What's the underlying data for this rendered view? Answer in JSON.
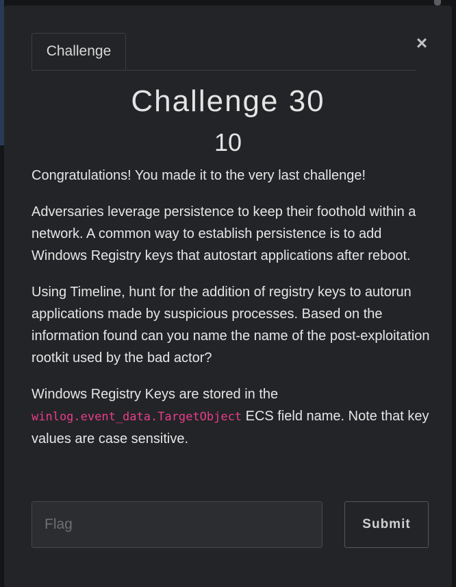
{
  "modal": {
    "tab_label": "Challenge",
    "close_symbol": "×",
    "title": "Challenge 30",
    "points": "10"
  },
  "description": {
    "para1": "Congratulations! You made it to the very last challenge!",
    "para2": "Adversaries leverage persistence to keep their foothold within a network. A common way to establish persistence is to add Windows Registry keys that autostart applications after reboot.",
    "para3": "Using Timeline, hunt for the addition of registry keys to autorun applications made by suspicious processes. Based on the information found can you name the name of the post-exploitation rootkit used by the bad actor?",
    "para4_before": "Windows Registry Keys are stored in the ",
    "para4_code": "winlog.event_data.TargetObject",
    "para4_after": " ECS field name. Note that key values are case sensitive."
  },
  "form": {
    "flag_placeholder": "Flag",
    "flag_value": "",
    "submit_label": "Submit"
  },
  "colors": {
    "code_text": "#e83e8c",
    "modal_bg": "#232427"
  },
  "icons": {
    "close": "close-icon"
  }
}
